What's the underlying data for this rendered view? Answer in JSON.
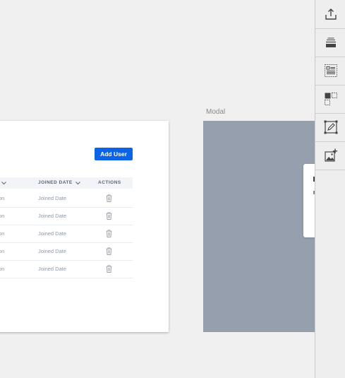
{
  "table_card": {
    "add_button_label": "Add User",
    "columns": [
      {
        "label": "",
        "sortable": true
      },
      {
        "label": "JOINED DATE",
        "sortable": true
      },
      {
        "label": "ACTIONS",
        "sortable": false
      }
    ],
    "rows": [
      {
        "partial": "on",
        "joined": "Joined Date"
      },
      {
        "partial": "on",
        "joined": "Joined Date"
      },
      {
        "partial": "on",
        "joined": "Joined Date"
      },
      {
        "partial": "on",
        "joined": "Joined Date"
      },
      {
        "partial": "on",
        "joined": "Joined Date"
      }
    ]
  },
  "modal_artboard": {
    "label": "Modal"
  },
  "toolbar": {
    "tools": [
      {
        "name": "export-icon"
      },
      {
        "name": "text-style-icon"
      },
      {
        "name": "list-layout-icon"
      },
      {
        "name": "component-select-icon"
      },
      {
        "name": "edit-frame-icon"
      },
      {
        "name": "add-image-icon"
      }
    ]
  },
  "colors": {
    "primary": "#0b63e5",
    "modal_overlay": "#959fae",
    "canvas": "#f0f0f0"
  }
}
